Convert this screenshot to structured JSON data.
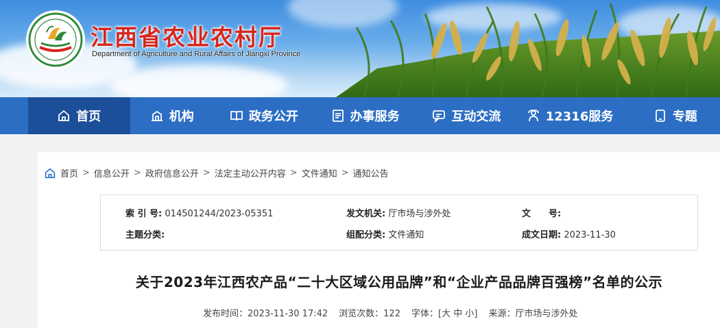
{
  "site": {
    "name_cn": "江西省农业农村厅",
    "name_en": "Department of Agriculture and Rural Affairs of Jiangxi Province"
  },
  "nav": [
    {
      "label": "首页",
      "icon": "home-icon",
      "active": true
    },
    {
      "label": "机构",
      "icon": "building-icon"
    },
    {
      "label": "政务公开",
      "icon": "book-icon"
    },
    {
      "label": "办事服务",
      "icon": "document-icon"
    },
    {
      "label": "互动交流",
      "icon": "chat-icon"
    },
    {
      "label": "12316服务",
      "icon": "phone-service-icon"
    },
    {
      "label": "专题",
      "icon": "tablet-icon"
    }
  ],
  "breadcrumb": [
    "首页",
    "信息公开",
    "政府信息公开",
    "法定主动公开内容",
    "文件通知",
    "通知公告"
  ],
  "meta": {
    "index_label": "索 引 号:",
    "index_value": "014501244/2023-05351",
    "issuer_label": "发文机关:",
    "issuer_value": "厅市场与涉外处",
    "docno_label": "文　　号:",
    "docno_value": "",
    "topic_label": "主题分类:",
    "topic_value": "",
    "category_label": "组配分类:",
    "category_value": "文件通知",
    "date_label": "成文日期:",
    "date_value": "2023-11-30"
  },
  "article": {
    "title": "关于2023年江西农产品“二十大区域公用品牌”和“企业产品品牌百强榜”名单的公示",
    "publish_time": "发布时间：2023-11-30 17:42",
    "views": "浏览次数：122",
    "font_label": "字体：[",
    "font_large": "大",
    "font_mid": "中",
    "font_small": "小",
    "font_end": "]",
    "source": "来源：厅市场与涉外处"
  },
  "colors": {
    "nav_bg": "#2c6ec4",
    "nav_active": "#1c4f9a",
    "brand_red": "#d7261e"
  }
}
